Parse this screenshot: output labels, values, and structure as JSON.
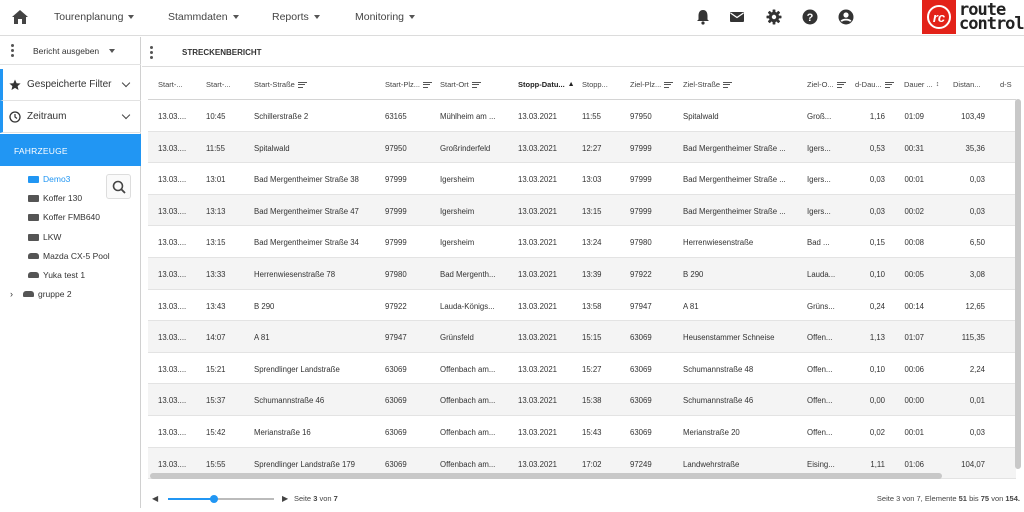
{
  "topbar": {
    "nav": [
      "Tourenplanung",
      "Stammdaten",
      "Reports",
      "Monitoring"
    ],
    "icons": [
      "bell-icon",
      "mail-icon",
      "gear-icon",
      "help-icon",
      "account-icon"
    ],
    "logo": {
      "mark": "rc",
      "line1": "route",
      "line2": "control",
      "color": "#e32219"
    }
  },
  "sidebar": {
    "action": "Bericht ausgeben",
    "saved_filters": "Gespeicherte Filter",
    "period": "Zeitraum",
    "vehicles_header": "FAHRZEUGE",
    "vehicles": [
      {
        "label": "Demo3",
        "type": "truck",
        "selected": true
      },
      {
        "label": "Koffer 130",
        "type": "truck"
      },
      {
        "label": "Koffer FMB640",
        "type": "truck"
      },
      {
        "label": "LKW",
        "type": "truck"
      },
      {
        "label": "Mazda CX-5 Pool",
        "type": "car"
      },
      {
        "label": "Yuka test 1",
        "type": "car"
      },
      {
        "label": "gruppe 2",
        "type": "car",
        "group": true
      }
    ]
  },
  "main": {
    "title": "STRECKENBERICHT",
    "columns": [
      "Start-...",
      "Start-...",
      "Start-Straße",
      "Start-Plz...",
      "Start-Ort",
      "Stopp-Datu...",
      "Stopp...",
      "Ziel-Plz...",
      "Ziel-Straße",
      "Ziel-O...",
      "d-Dau...",
      "Dauer ...",
      "Distan...",
      "d-S"
    ],
    "rows": [
      [
        "13.03....",
        "10:45",
        "Schillerstraße 2",
        "63165",
        "Mühlheim am ...",
        "13.03.2021",
        "11:55",
        "97950",
        "Spitalwald",
        "Groß...",
        "1,16",
        "01:09",
        "103,49"
      ],
      [
        "13.03....",
        "11:55",
        "Spitalwald",
        "97950",
        "Großrinderfeld",
        "13.03.2021",
        "12:27",
        "97999",
        "Bad Mergentheimer Straße ...",
        "Igers...",
        "0,53",
        "00:31",
        "35,36"
      ],
      [
        "13.03....",
        "13:01",
        "Bad Mergentheimer Straße 38",
        "97999",
        "Igersheim",
        "13.03.2021",
        "13:03",
        "97999",
        "Bad Mergentheimer Straße ...",
        "Igers...",
        "0,03",
        "00:01",
        "0,03"
      ],
      [
        "13.03....",
        "13:13",
        "Bad Mergentheimer Straße 47",
        "97999",
        "Igersheim",
        "13.03.2021",
        "13:15",
        "97999",
        "Bad Mergentheimer Straße ...",
        "Igers...",
        "0,03",
        "00:02",
        "0,03"
      ],
      [
        "13.03....",
        "13:15",
        "Bad Mergentheimer Straße 34",
        "97999",
        "Igersheim",
        "13.03.2021",
        "13:24",
        "97980",
        "Herrenwiesenstraße",
        "Bad ...",
        "0,15",
        "00:08",
        "6,50"
      ],
      [
        "13.03....",
        "13:33",
        "Herrenwiesenstraße 78",
        "97980",
        "Bad Mergenth...",
        "13.03.2021",
        "13:39",
        "97922",
        "B 290",
        "Lauda...",
        "0,10",
        "00:05",
        "3,08"
      ],
      [
        "13.03....",
        "13:43",
        "B 290",
        "97922",
        "Lauda-Königs...",
        "13.03.2021",
        "13:58",
        "97947",
        "A 81",
        "Grüns...",
        "0,24",
        "00:14",
        "12,65"
      ],
      [
        "13.03....",
        "14:07",
        "A 81",
        "97947",
        "Grünsfeld",
        "13.03.2021",
        "15:15",
        "63069",
        "Heusenstammer Schneise",
        "Offen...",
        "1,13",
        "01:07",
        "115,35"
      ],
      [
        "13.03....",
        "15:21",
        "Sprendlinger Landstraße",
        "63069",
        "Offenbach am...",
        "13.03.2021",
        "15:27",
        "63069",
        "Schumannstraße 48",
        "Offen...",
        "0,10",
        "00:06",
        "2,24"
      ],
      [
        "13.03....",
        "15:37",
        "Schumannstraße 46",
        "63069",
        "Offenbach am...",
        "13.03.2021",
        "15:38",
        "63069",
        "Schumannstraße 46",
        "Offen...",
        "0,00",
        "00:00",
        "0,01"
      ],
      [
        "13.03....",
        "15:42",
        "Merianstraße 16",
        "63069",
        "Offenbach am...",
        "13.03.2021",
        "15:43",
        "63069",
        "Merianstraße 20",
        "Offen...",
        "0,02",
        "00:01",
        "0,03"
      ],
      [
        "13.03....",
        "15:55",
        "Sprendlinger Landstraße 179",
        "63069",
        "Offenbach am...",
        "13.03.2021",
        "17:02",
        "97249",
        "Landwehrstraße",
        "Eising...",
        "1,11",
        "01:06",
        "104,07"
      ]
    ]
  },
  "footer": {
    "page_prefix": "Seite",
    "page_current": "3",
    "page_of": "von",
    "page_total": "7",
    "page_progress": 0.43,
    "summary_prefix": "Seite 3 von 7, Elemente",
    "from": "51",
    "bis": "bis",
    "to": "75",
    "von": "von",
    "total": "154."
  },
  "colors": {
    "accent": "#2196f3",
    "brand": "#e32219"
  }
}
